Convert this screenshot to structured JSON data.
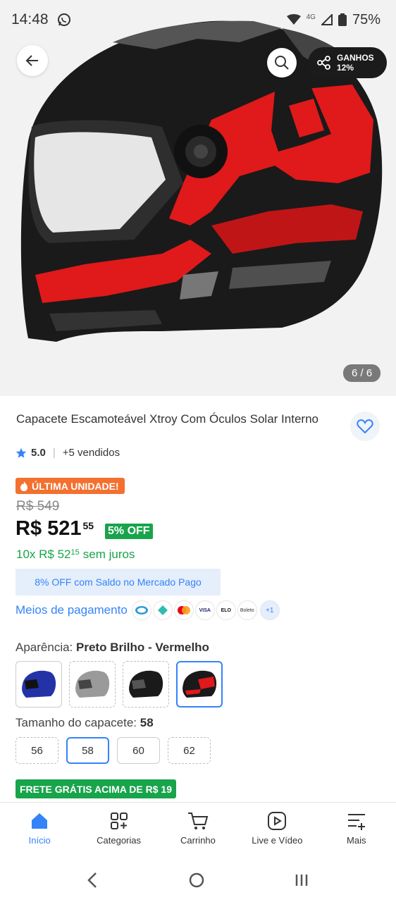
{
  "status_bar": {
    "time": "14:48",
    "network": "4G",
    "battery": "75%"
  },
  "hero": {
    "ganhos_label": "GANHOS",
    "ganhos_value": "12%",
    "image_counter": "6 / 6"
  },
  "product": {
    "title": "Capacete Escamoteável Xtroy Com Óculos Solar Interno",
    "rating": "5.0",
    "sold": "+5 vendidos",
    "last_unit_badge": "ÚLTIMA UNIDADE!",
    "old_price": "R$ 549",
    "price_main": "R$ 521",
    "price_cents": "55",
    "discount": "5% OFF",
    "installment_main": "10x R$ 52",
    "installment_cents": "15",
    "installment_suffix": "sem juros",
    "saldo_banner": "8% OFF com Saldo no Mercado Pago",
    "payment_link": "Meios de pagamento",
    "payment_icons": [
      "mercado-pago-icon",
      "pix-icon",
      "mastercard-icon",
      "visa-icon",
      "elo-icon",
      "boleto-icon"
    ],
    "payment_icon_labels": {
      "visa": "VISA",
      "elo": "ELO",
      "boleto": "Boleto"
    },
    "payment_more": "+1"
  },
  "variations": {
    "appearance_label": "Aparência:",
    "appearance_value": "Preto Brilho - Vermelho",
    "swatches": [
      {
        "name": "Azul",
        "color": "#2432a8"
      },
      {
        "name": "Cinza",
        "color": "#9a9a9a"
      },
      {
        "name": "Preto",
        "color": "#1a1a1a"
      },
      {
        "name": "Preto Brilho - Vermelho",
        "color": "#d61a1a",
        "selected": true
      }
    ],
    "size_label": "Tamanho do capacete:",
    "size_value": "58",
    "sizes": [
      "56",
      "58",
      "60",
      "62"
    ],
    "selected_size": "58"
  },
  "shipping_badge": "FRETE GRÁTIS ACIMA DE R$ 19",
  "bottom_nav": [
    {
      "label": "Início",
      "icon": "home-icon",
      "active": true
    },
    {
      "label": "Categorias",
      "icon": "categories-icon"
    },
    {
      "label": "Carrinho",
      "icon": "cart-icon"
    },
    {
      "label": "Live e Vídeo",
      "icon": "play-icon"
    },
    {
      "label": "Mais",
      "icon": "menu-plus-icon"
    }
  ],
  "colors": {
    "accent_blue": "#3483fa",
    "success_green": "#18a44b",
    "orange_badge": "#f3702f",
    "helmet_red": "#e0191b"
  }
}
